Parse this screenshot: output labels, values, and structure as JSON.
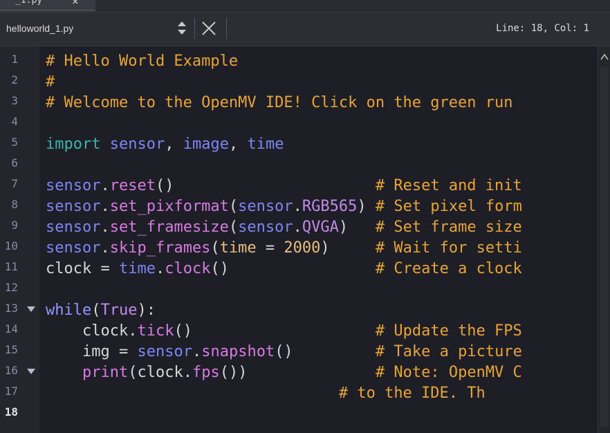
{
  "tab": {
    "label": "_1.py",
    "close_glyph": "×"
  },
  "toolbar": {
    "file_name": "helloworld_1.py",
    "cursor_position": "Line: 18, Col: 1"
  },
  "editor": {
    "line_numbers": [
      "1",
      "2",
      "3",
      "4",
      "5",
      "6",
      "7",
      "8",
      "9",
      "10",
      "11",
      "12",
      "13",
      "14",
      "15",
      "16",
      "17",
      "18"
    ],
    "current_line": "18"
  },
  "colors": {
    "background": "#1e1e27",
    "gutter": "#25252e",
    "comment": "#e8a534",
    "import_keyword": "#38b5a6",
    "module": "#7d86f3",
    "function": "#d67be0",
    "number": "#e8c07a"
  },
  "icons": {
    "file_select": "up-down-arrows-icon",
    "close": "close-icon",
    "fold": "fold-arrow-icon",
    "scroll_up": "chevron-up-icon"
  }
}
